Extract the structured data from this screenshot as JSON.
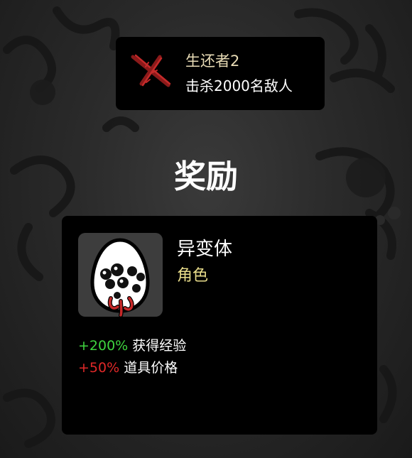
{
  "achievement": {
    "title": "生还者2",
    "description": "击杀2000名敌人",
    "icon": "crossed-red-scratch-icon",
    "title_color": "#e9dcb6"
  },
  "reward": {
    "heading": "奖励",
    "character": {
      "name": "异变体",
      "type": "角色",
      "icon": "mutant-egg-character-icon",
      "type_color": "#e8dc8a"
    },
    "stats": [
      {
        "value": "+200%",
        "label": "获得经验",
        "color": "#3fd43f"
      },
      {
        "value": "+50%",
        "label": "道具价格",
        "color": "#e02828"
      }
    ]
  }
}
